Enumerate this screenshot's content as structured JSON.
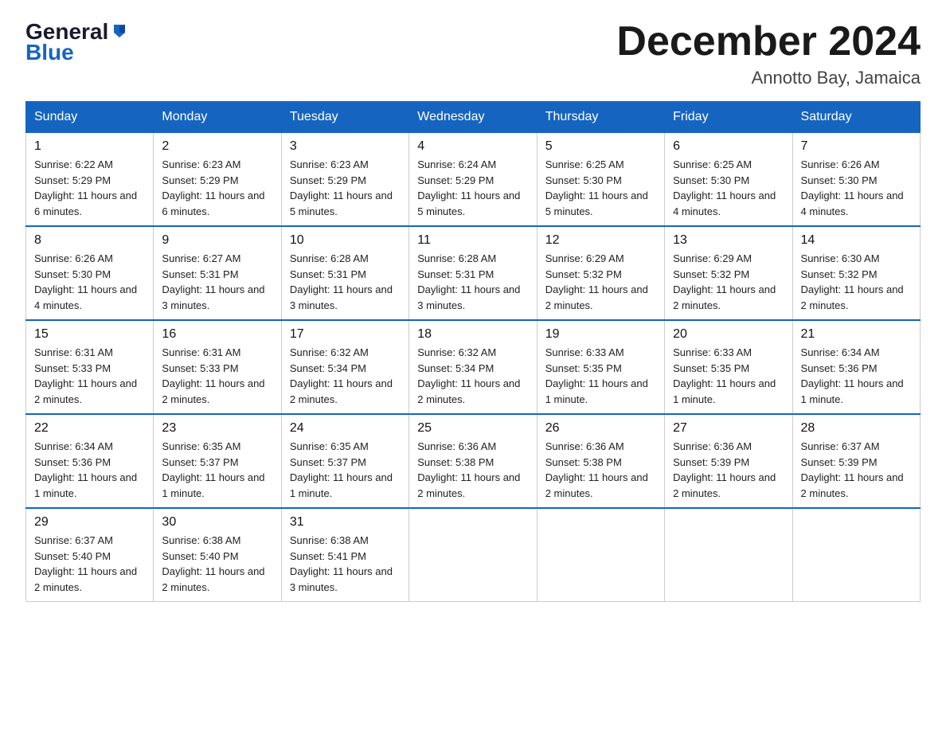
{
  "header": {
    "logo_general": "General",
    "logo_blue": "Blue",
    "title": "December 2024",
    "location": "Annotto Bay, Jamaica"
  },
  "weekdays": [
    "Sunday",
    "Monday",
    "Tuesday",
    "Wednesday",
    "Thursday",
    "Friday",
    "Saturday"
  ],
  "weeks": [
    [
      {
        "day": "1",
        "sunrise": "6:22 AM",
        "sunset": "5:29 PM",
        "daylight": "11 hours and 6 minutes."
      },
      {
        "day": "2",
        "sunrise": "6:23 AM",
        "sunset": "5:29 PM",
        "daylight": "11 hours and 6 minutes."
      },
      {
        "day": "3",
        "sunrise": "6:23 AM",
        "sunset": "5:29 PM",
        "daylight": "11 hours and 5 minutes."
      },
      {
        "day": "4",
        "sunrise": "6:24 AM",
        "sunset": "5:29 PM",
        "daylight": "11 hours and 5 minutes."
      },
      {
        "day": "5",
        "sunrise": "6:25 AM",
        "sunset": "5:30 PM",
        "daylight": "11 hours and 5 minutes."
      },
      {
        "day": "6",
        "sunrise": "6:25 AM",
        "sunset": "5:30 PM",
        "daylight": "11 hours and 4 minutes."
      },
      {
        "day": "7",
        "sunrise": "6:26 AM",
        "sunset": "5:30 PM",
        "daylight": "11 hours and 4 minutes."
      }
    ],
    [
      {
        "day": "8",
        "sunrise": "6:26 AM",
        "sunset": "5:30 PM",
        "daylight": "11 hours and 4 minutes."
      },
      {
        "day": "9",
        "sunrise": "6:27 AM",
        "sunset": "5:31 PM",
        "daylight": "11 hours and 3 minutes."
      },
      {
        "day": "10",
        "sunrise": "6:28 AM",
        "sunset": "5:31 PM",
        "daylight": "11 hours and 3 minutes."
      },
      {
        "day": "11",
        "sunrise": "6:28 AM",
        "sunset": "5:31 PM",
        "daylight": "11 hours and 3 minutes."
      },
      {
        "day": "12",
        "sunrise": "6:29 AM",
        "sunset": "5:32 PM",
        "daylight": "11 hours and 2 minutes."
      },
      {
        "day": "13",
        "sunrise": "6:29 AM",
        "sunset": "5:32 PM",
        "daylight": "11 hours and 2 minutes."
      },
      {
        "day": "14",
        "sunrise": "6:30 AM",
        "sunset": "5:32 PM",
        "daylight": "11 hours and 2 minutes."
      }
    ],
    [
      {
        "day": "15",
        "sunrise": "6:31 AM",
        "sunset": "5:33 PM",
        "daylight": "11 hours and 2 minutes."
      },
      {
        "day": "16",
        "sunrise": "6:31 AM",
        "sunset": "5:33 PM",
        "daylight": "11 hours and 2 minutes."
      },
      {
        "day": "17",
        "sunrise": "6:32 AM",
        "sunset": "5:34 PM",
        "daylight": "11 hours and 2 minutes."
      },
      {
        "day": "18",
        "sunrise": "6:32 AM",
        "sunset": "5:34 PM",
        "daylight": "11 hours and 2 minutes."
      },
      {
        "day": "19",
        "sunrise": "6:33 AM",
        "sunset": "5:35 PM",
        "daylight": "11 hours and 1 minute."
      },
      {
        "day": "20",
        "sunrise": "6:33 AM",
        "sunset": "5:35 PM",
        "daylight": "11 hours and 1 minute."
      },
      {
        "day": "21",
        "sunrise": "6:34 AM",
        "sunset": "5:36 PM",
        "daylight": "11 hours and 1 minute."
      }
    ],
    [
      {
        "day": "22",
        "sunrise": "6:34 AM",
        "sunset": "5:36 PM",
        "daylight": "11 hours and 1 minute."
      },
      {
        "day": "23",
        "sunrise": "6:35 AM",
        "sunset": "5:37 PM",
        "daylight": "11 hours and 1 minute."
      },
      {
        "day": "24",
        "sunrise": "6:35 AM",
        "sunset": "5:37 PM",
        "daylight": "11 hours and 1 minute."
      },
      {
        "day": "25",
        "sunrise": "6:36 AM",
        "sunset": "5:38 PM",
        "daylight": "11 hours and 2 minutes."
      },
      {
        "day": "26",
        "sunrise": "6:36 AM",
        "sunset": "5:38 PM",
        "daylight": "11 hours and 2 minutes."
      },
      {
        "day": "27",
        "sunrise": "6:36 AM",
        "sunset": "5:39 PM",
        "daylight": "11 hours and 2 minutes."
      },
      {
        "day": "28",
        "sunrise": "6:37 AM",
        "sunset": "5:39 PM",
        "daylight": "11 hours and 2 minutes."
      }
    ],
    [
      {
        "day": "29",
        "sunrise": "6:37 AM",
        "sunset": "5:40 PM",
        "daylight": "11 hours and 2 minutes."
      },
      {
        "day": "30",
        "sunrise": "6:38 AM",
        "sunset": "5:40 PM",
        "daylight": "11 hours and 2 minutes."
      },
      {
        "day": "31",
        "sunrise": "6:38 AM",
        "sunset": "5:41 PM",
        "daylight": "11 hours and 3 minutes."
      },
      null,
      null,
      null,
      null
    ]
  ],
  "labels": {
    "sunrise": "Sunrise: ",
    "sunset": "Sunset: ",
    "daylight": "Daylight: "
  }
}
